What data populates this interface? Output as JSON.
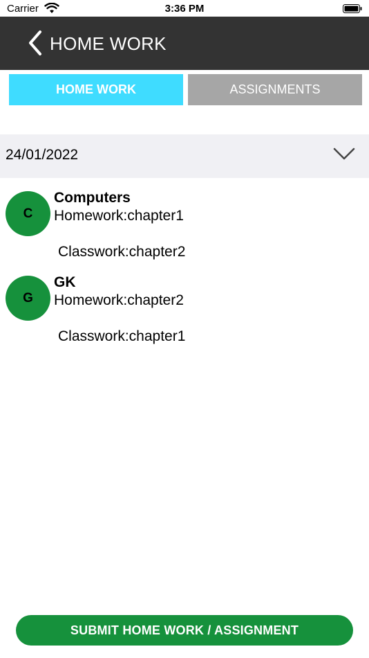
{
  "status_bar": {
    "carrier": "Carrier",
    "time": "3:36 PM",
    "wifi_icon": "wifi-icon",
    "battery_icon": "battery-icon"
  },
  "nav": {
    "title": "HOME WORK",
    "back_icon": "chevron-left-icon"
  },
  "tabs": [
    {
      "label": "HOME WORK",
      "active": true,
      "color": "#3fdcff"
    },
    {
      "label": "ASSIGNMENTS",
      "active": false,
      "color": "#a6a6a6"
    }
  ],
  "date_selector": {
    "value": "24/01/2022",
    "icon": "chevron-down-icon"
  },
  "subjects": [
    {
      "initial": "C",
      "name": "Computers",
      "homework": "Homework:chapter1",
      "classwork": "Classwork:chapter2"
    },
    {
      "initial": "G",
      "name": "GK",
      "homework": "Homework:chapter2",
      "classwork": "Classwork:chapter1"
    }
  ],
  "submit_button": {
    "label": "SUBMIT HOME WORK / ASSIGNMENT"
  },
  "colors": {
    "nav_bg": "#333333",
    "accent_green": "#16913c",
    "tab_active": "#3fdcff",
    "tab_inactive": "#a6a6a6"
  }
}
